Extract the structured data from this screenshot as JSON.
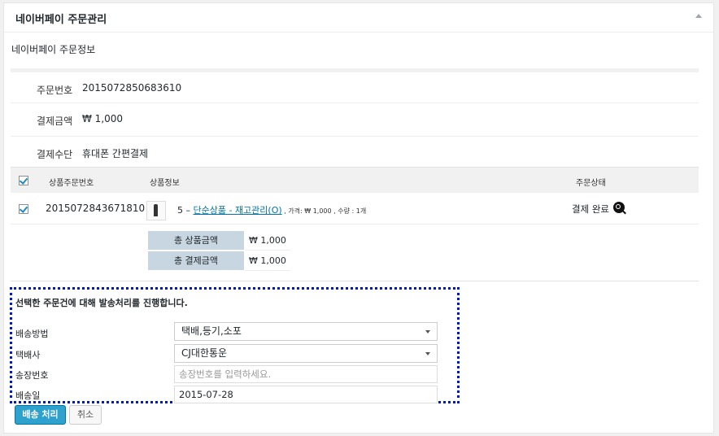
{
  "panel": {
    "title": "네이버페이 주문관리"
  },
  "info": {
    "section_title": "네이버페이 주문정보",
    "rows": [
      {
        "label": "주문번호",
        "value": "2015072850683610"
      },
      {
        "label": "결제금액",
        "value": "₩ 1,000"
      },
      {
        "label": "결제수단",
        "value": "휴대폰 간편결제"
      }
    ]
  },
  "orders": {
    "columns": {
      "id": "상품주문번호",
      "product": "상품정보",
      "status": "주문상태"
    },
    "items": [
      {
        "checked": true,
        "id": "2015072843671810",
        "prefix": "5 – ",
        "product_link": "단순상품 - 재고관리(O)",
        "meta": " , 가격: ₩ 1,000 , 수량 : 1개",
        "status": "결제 완료",
        "status_icon": "zoom-icon"
      }
    ],
    "header_checked": true
  },
  "totals": [
    {
      "label": "총 상품금액",
      "value": "₩ 1,000"
    },
    {
      "label": "총 결제금액",
      "value": "₩ 1,000"
    }
  ],
  "shipping": {
    "title": "선택한 주문건에 대해 발송처리를 진행합니다.",
    "method_label": "배송방법",
    "method_value": "택배,등기,소포",
    "courier_label": "택배사",
    "courier_value": "CJ대한통운",
    "tracking_label": "송장번호",
    "tracking_placeholder": "송장번호를 입력하세요.",
    "date_label": "배송일",
    "date_value": "2015-07-28"
  },
  "buttons": {
    "ship": "배송 처리",
    "cancel": "취소"
  },
  "colors": {
    "accent": "#2ea2cc",
    "highlight_border": "#0018c8",
    "total_label_bg": "#c7d6e0"
  }
}
